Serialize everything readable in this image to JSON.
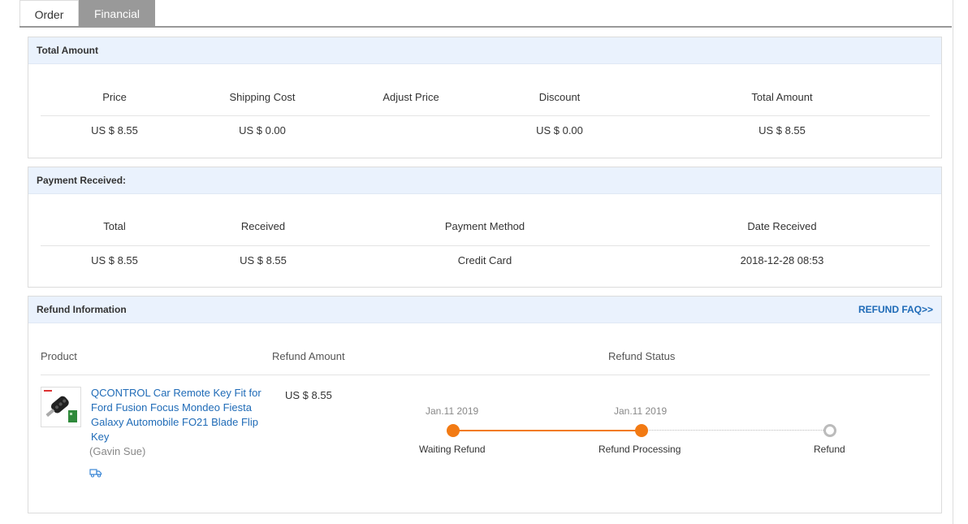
{
  "tabs": [
    {
      "label": "Order"
    },
    {
      "label": "Financial"
    }
  ],
  "total_amount": {
    "title": "Total Amount",
    "headers": [
      "Price",
      "Shipping Cost",
      "Adjust Price",
      "Discount",
      "Total Amount"
    ],
    "values": [
      "US $ 8.55",
      "US $ 0.00",
      "",
      "US $ 0.00",
      "US $ 8.55"
    ]
  },
  "payment": {
    "title": "Payment Received:",
    "headers": [
      "Total",
      "Received",
      "Payment Method",
      "Date Received"
    ],
    "values": [
      "US $ 8.55",
      "US $ 8.55",
      "Credit Card",
      "2018-12-28 08:53"
    ]
  },
  "refund": {
    "title": "Refund Information",
    "faq_link": "REFUND FAQ>>",
    "headers": {
      "product": "Product",
      "amount": "Refund Amount",
      "status": "Refund Status"
    },
    "product_name": "QCONTROL Car Remote Key Fit for Ford Fusion Focus Mondeo Fiesta Galaxy Automobile FO21 Blade Flip Key",
    "seller": "(Gavin Sue)",
    "amount": "US $ 8.55",
    "timeline": [
      {
        "date": "Jan.11 2019",
        "label": "Waiting Refund",
        "done": true
      },
      {
        "date": "Jan.11 2019",
        "label": "Refund Processing",
        "done": true
      },
      {
        "date": "",
        "label": "Refund",
        "done": false
      }
    ]
  },
  "colors": {
    "accent_orange": "#f27a13",
    "link_blue": "#1f6bb7",
    "panel_header_bg": "#eaf2fd",
    "active_tab_bg": "#999999"
  },
  "icons": {
    "shipping": "truck-icon"
  }
}
